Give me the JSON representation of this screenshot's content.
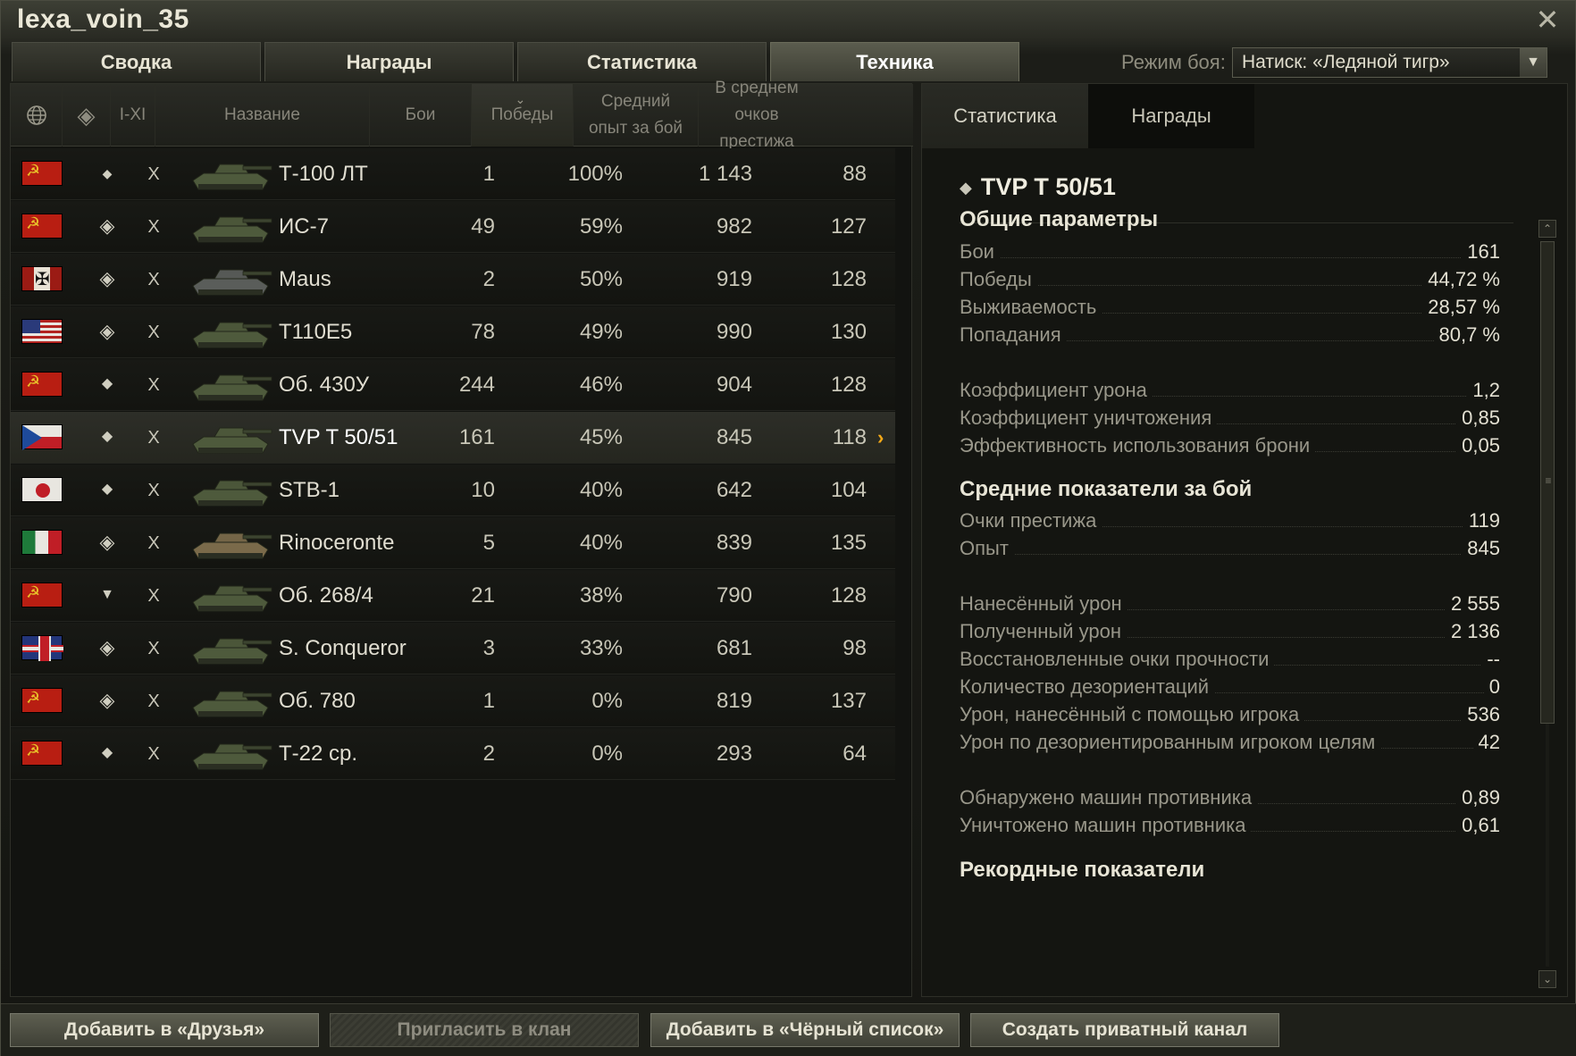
{
  "window": {
    "title": "lexa_voin_35"
  },
  "tabs": [
    {
      "label": "Сводка",
      "active": false
    },
    {
      "label": "Награды",
      "active": false
    },
    {
      "label": "Статистика",
      "active": false
    },
    {
      "label": "Техника",
      "active": true
    }
  ],
  "battle_mode": {
    "label": "Режим боя:",
    "value": "Натиск: «Ледяной тигр»"
  },
  "table": {
    "headers": {
      "nation": "nation-icon",
      "type": "type-icon",
      "tier": "I-XI",
      "name": "Название",
      "battles": "Бои",
      "wins": "Победы",
      "avg_exp_1": "Средний",
      "avg_exp_2": "опыт за бой",
      "avg_prestige_1": "В среднем",
      "avg_prestige_2": "очков престижа"
    },
    "rows": [
      {
        "flag": "ussr",
        "type": "light-tank-icon",
        "tier": "X",
        "name": "Т-100 ЛТ",
        "battles": "1",
        "wins": "100%",
        "exp": "1 143",
        "prestige": "88"
      },
      {
        "flag": "ussr",
        "type": "heavy-tank-icon",
        "tier": "X",
        "name": "ИС-7",
        "battles": "49",
        "wins": "59%",
        "exp": "982",
        "prestige": "127"
      },
      {
        "flag": "germany",
        "type": "heavy-tank-icon",
        "tier": "X",
        "name": "Maus",
        "battles": "2",
        "wins": "50%",
        "exp": "919",
        "prestige": "128"
      },
      {
        "flag": "usa",
        "type": "heavy-tank-icon",
        "tier": "X",
        "name": "T110E5",
        "battles": "78",
        "wins": "49%",
        "exp": "990",
        "prestige": "130"
      },
      {
        "flag": "ussr",
        "type": "medium-tank-icon",
        "tier": "X",
        "name": "Об. 430У",
        "battles": "244",
        "wins": "46%",
        "exp": "904",
        "prestige": "128"
      },
      {
        "flag": "czech",
        "type": "medium-tank-icon",
        "tier": "X",
        "name": "TVP T 50/51",
        "battles": "161",
        "wins": "45%",
        "exp": "845",
        "prestige": "118",
        "selected": true
      },
      {
        "flag": "japan",
        "type": "medium-tank-icon",
        "tier": "X",
        "name": "STB-1",
        "battles": "10",
        "wins": "40%",
        "exp": "642",
        "prestige": "104"
      },
      {
        "flag": "italy",
        "type": "heavy-tank-icon",
        "tier": "X",
        "name": "Rinoceronte",
        "battles": "5",
        "wins": "40%",
        "exp": "839",
        "prestige": "135"
      },
      {
        "flag": "ussr",
        "type": "td-icon",
        "tier": "X",
        "name": "Об. 268/4",
        "battles": "21",
        "wins": "38%",
        "exp": "790",
        "prestige": "128"
      },
      {
        "flag": "uk",
        "type": "heavy-tank-icon",
        "tier": "X",
        "name": "S. Conqueror",
        "battles": "3",
        "wins": "33%",
        "exp": "681",
        "prestige": "98"
      },
      {
        "flag": "ussr",
        "type": "heavy-tank-icon",
        "tier": "X",
        "name": "Об. 780",
        "battles": "1",
        "wins": "0%",
        "exp": "819",
        "prestige": "137"
      },
      {
        "flag": "ussr",
        "type": "medium-tank-icon",
        "tier": "X",
        "name": "Т-22 ср.",
        "battles": "2",
        "wins": "0%",
        "exp": "293",
        "prestige": "64"
      }
    ]
  },
  "details": {
    "tabs": [
      {
        "label": "Статистика",
        "active": true
      },
      {
        "label": "Награды",
        "active": false
      }
    ],
    "vehicle_name": "TVP T 50/51",
    "sections": [
      {
        "title": "Общие параметры",
        "stats": [
          {
            "label": "Бои",
            "value": "161"
          },
          {
            "label": "Победы",
            "value": "44,72 %"
          },
          {
            "label": "Выживаемость",
            "value": "28,57 %"
          },
          {
            "label": "Попадания",
            "value": "80,7 %"
          },
          {
            "label": "Коэффициент урона",
            "value": "1,2"
          },
          {
            "label": "Коэффициент уничтожения",
            "value": "0,85"
          },
          {
            "label": "Эффективность использования брони",
            "value": "0,05"
          }
        ]
      },
      {
        "title": "Средние показатели за бой",
        "stats": [
          {
            "label": "Очки престижа",
            "value": "119"
          },
          {
            "label": "Опыт",
            "value": "845"
          },
          {
            "label": "Нанесённый урон",
            "value": "2 555"
          },
          {
            "label": "Полученный урон",
            "value": "2 136"
          },
          {
            "label": "Восстановленные очки прочности",
            "value": "--"
          },
          {
            "label": "Количество дезориентаций",
            "value": "0"
          },
          {
            "label": "Урон, нанесённый с помощью игрока",
            "value": "536"
          },
          {
            "label": "Урон по дезориентированным игроком целям",
            "value": "42"
          },
          {
            "label": "Обнаружено машин противника",
            "value": "0,89"
          },
          {
            "label": "Уничтожено машин противника",
            "value": "0,61"
          }
        ]
      },
      {
        "title": "Рекордные показатели",
        "stats": []
      }
    ]
  },
  "buttons": {
    "add_friend": "Добавить в «Друзья»",
    "invite_clan": "Пригласить в клан",
    "add_blacklist": "Добавить в «Чёрный список»",
    "private_channel": "Создать приватный канал"
  },
  "colors": {
    "accent": "#f2a818",
    "background": "#151612",
    "text": "#c8c6b8"
  }
}
